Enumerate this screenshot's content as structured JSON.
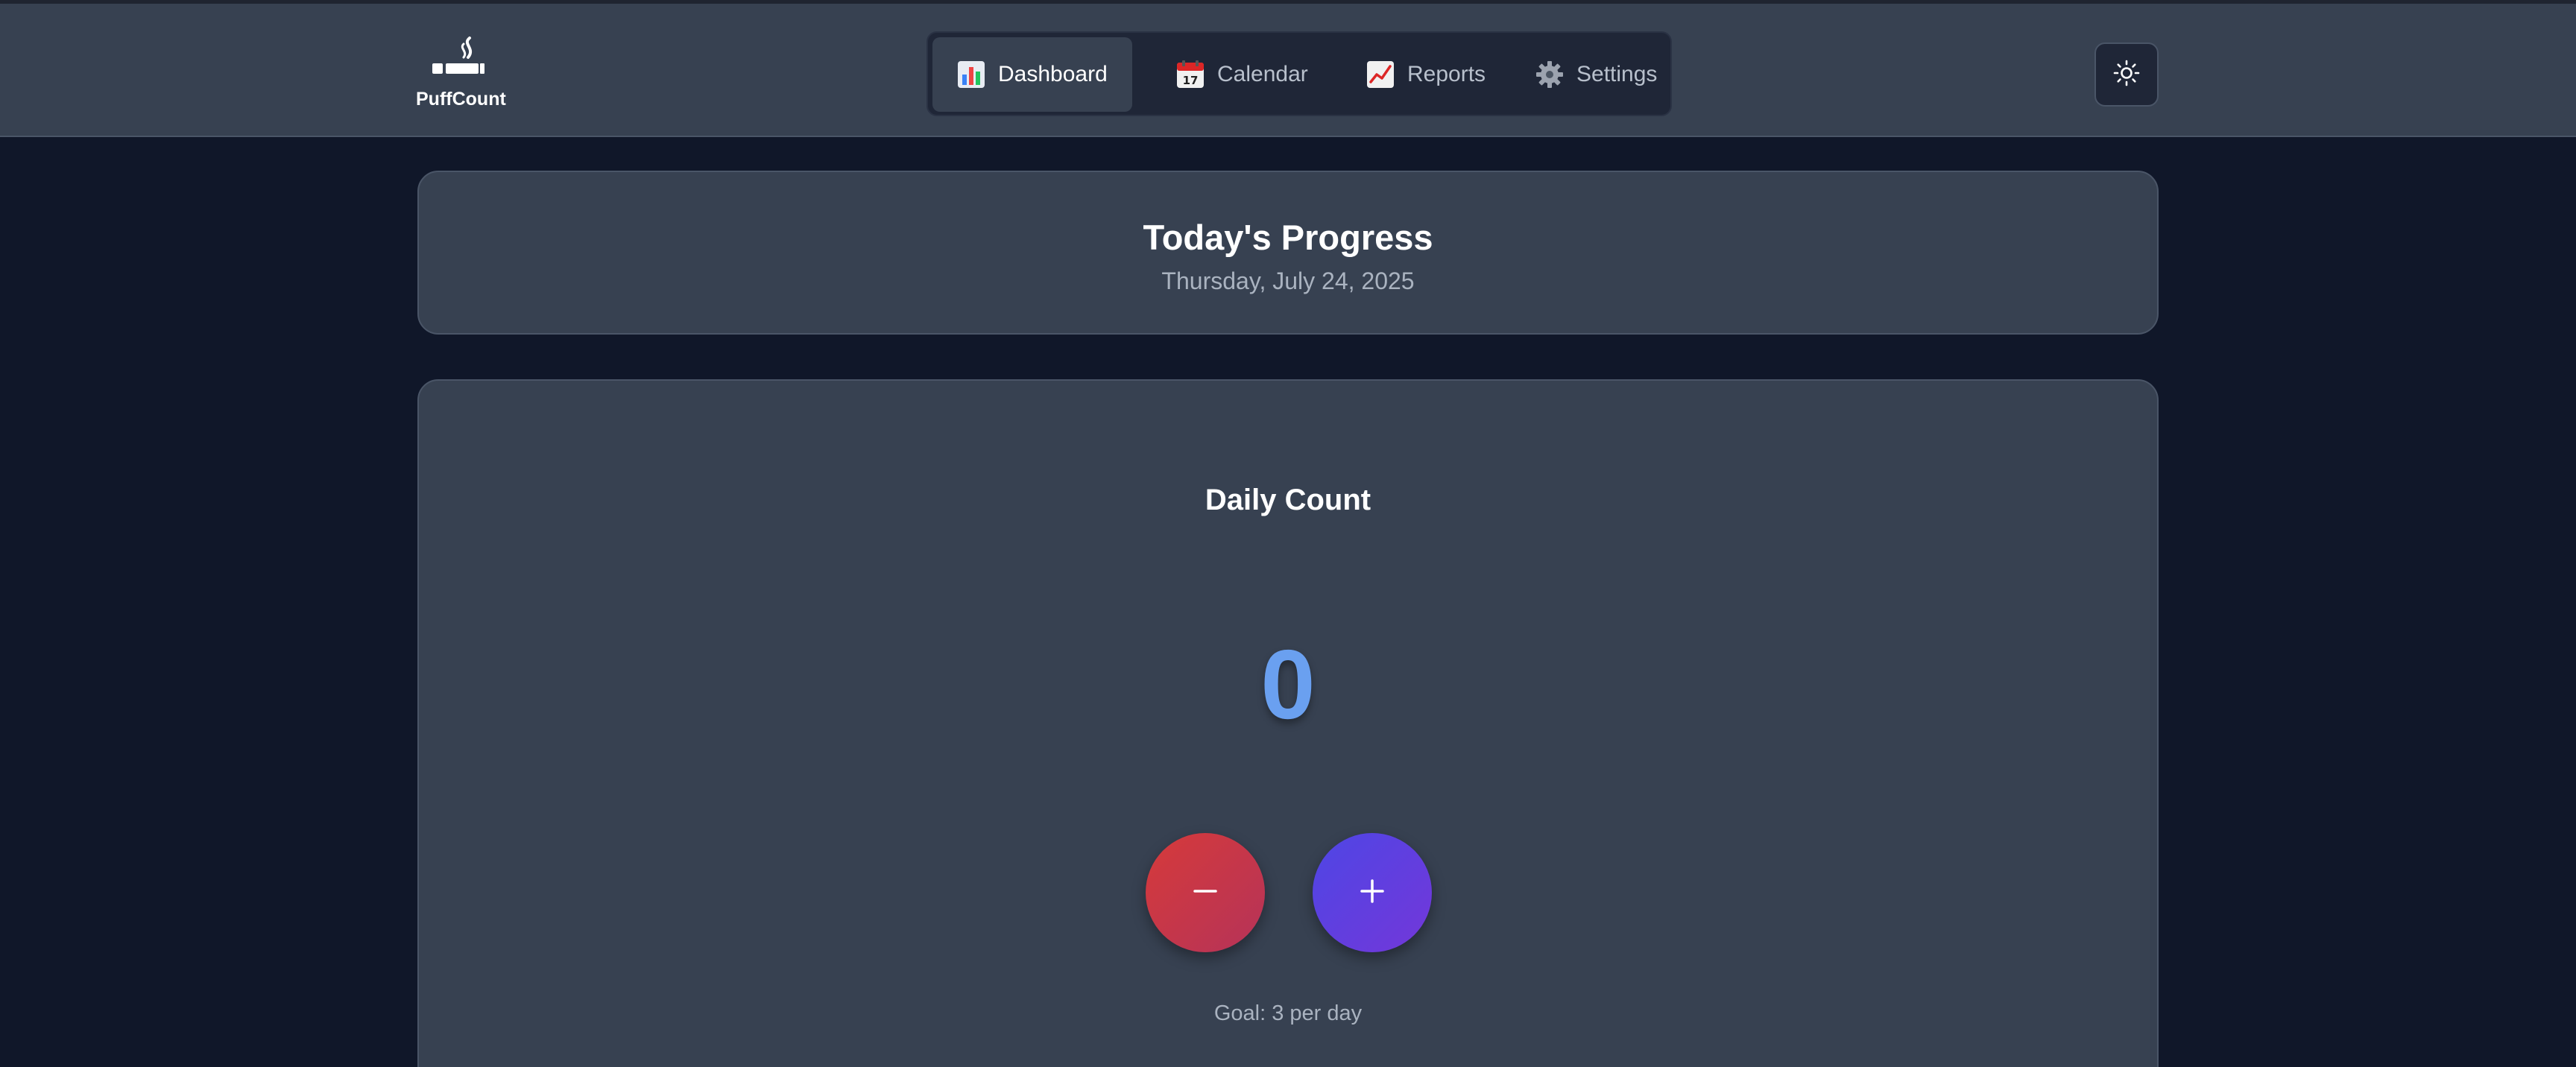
{
  "app": {
    "name": "PuffCount"
  },
  "nav": {
    "items": [
      {
        "label": "Dashboard",
        "icon": "bar-chart-icon",
        "active": true
      },
      {
        "label": "Calendar",
        "icon": "calendar-icon",
        "active": false
      },
      {
        "label": "Reports",
        "icon": "trend-chart-icon",
        "active": false
      },
      {
        "label": "Settings",
        "icon": "gear-icon",
        "active": false
      }
    ]
  },
  "theme_toggle": {
    "icon": "sun-icon"
  },
  "header": {
    "title": "Today's Progress",
    "date": "Thursday, July 24, 2025"
  },
  "counter": {
    "title": "Daily Count",
    "value": "0",
    "decrement_label": "−",
    "increment_label": "+",
    "goal_text": "Goal: 3 per day"
  },
  "colors": {
    "background": "#101729",
    "surface": "#374151",
    "accent_count": "#6aa0f0",
    "decrement": "#d63a3a",
    "increment": "#5b3fe0"
  }
}
